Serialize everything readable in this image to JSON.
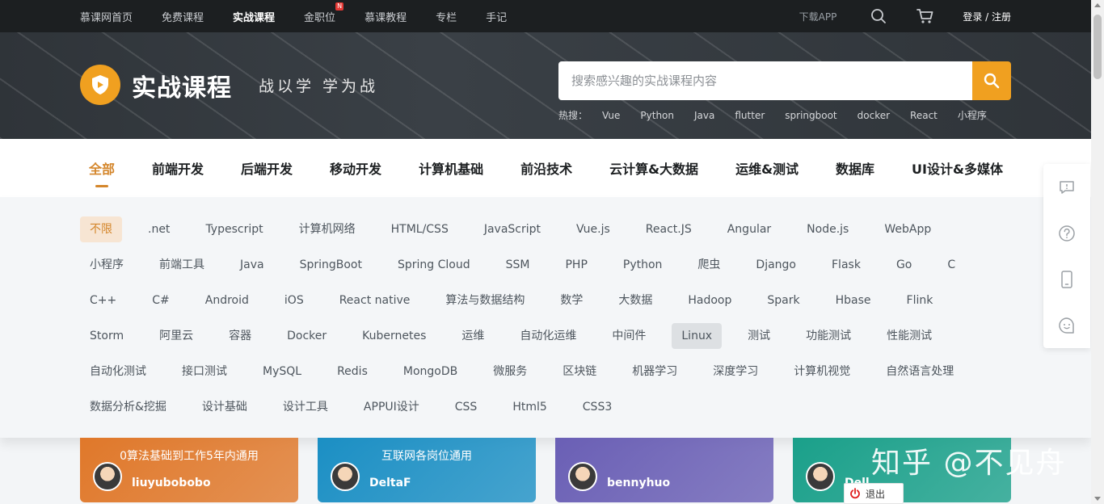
{
  "topnav": {
    "links": [
      {
        "label": "慕课网首页"
      },
      {
        "label": "免费课程"
      },
      {
        "label": "实战课程",
        "active": true
      },
      {
        "label": "金职位",
        "badge": "N"
      },
      {
        "label": "慕课教程"
      },
      {
        "label": "专栏"
      },
      {
        "label": "手记"
      }
    ],
    "download_label": "下载APP",
    "login_label": "登录 / 注册",
    "icons": [
      "search-icon",
      "cart-icon"
    ]
  },
  "hero": {
    "title": "实战课程",
    "slogan": "战以学 学为战",
    "search": {
      "placeholder": "搜索感兴趣的实战课程内容",
      "value": ""
    },
    "hot_label": "热搜：",
    "hot_tags": [
      "Vue",
      "Python",
      "Java",
      "flutter",
      "springboot",
      "docker",
      "React",
      "小程序"
    ]
  },
  "categories": [
    {
      "label": "全部",
      "active": true
    },
    {
      "label": "前端开发"
    },
    {
      "label": "后端开发"
    },
    {
      "label": "移动开发"
    },
    {
      "label": "计算机基础"
    },
    {
      "label": "前沿技术"
    },
    {
      "label": "云计算&大数据"
    },
    {
      "label": "运维&测试"
    },
    {
      "label": "数据库"
    },
    {
      "label": "UI设计&多媒体"
    }
  ],
  "subcategories": [
    "不限",
    ".net",
    "Typescript",
    "计算机网络",
    "HTML/CSS",
    "JavaScript",
    "Vue.js",
    "React.JS",
    "Angular",
    "Node.js",
    "WebApp",
    "小程序",
    "前端工具",
    "Java",
    "SpringBoot",
    "Spring Cloud",
    "SSM",
    "PHP",
    "Python",
    "爬虫",
    "Django",
    "Flask",
    "Go",
    "C",
    "C++",
    "C#",
    "Android",
    "iOS",
    "React native",
    "算法与数据结构",
    "数学",
    "大数据",
    "Hadoop",
    "Spark",
    "Hbase",
    "Flink",
    "Storm",
    "阿里云",
    "容器",
    "Docker",
    "Kubernetes",
    "运维",
    "自动化运维",
    "中间件",
    "Linux",
    "测试",
    "功能测试",
    "性能测试",
    "自动化测试",
    "接口测试",
    "MySQL",
    "Redis",
    "MongoDB",
    "微服务",
    "区块链",
    "机器学习",
    "深度学习",
    "计算机视觉",
    "自然语言处理",
    "数据分析&挖掘",
    "设计基础",
    "设计工具",
    "APPUI设计",
    "CSS",
    "Html5",
    "CSS3"
  ],
  "subcategory_active": "不限",
  "subcategory_hover": "Linux",
  "cards": [
    {
      "subtitle": "0算法基础到工作5年内通用",
      "author": "liuyubobobo",
      "color": "#e0782a"
    },
    {
      "subtitle": "互联网各岗位通用",
      "author": "DeltaF",
      "color": "#1b8fc4"
    },
    {
      "subtitle": "",
      "author": "bennyhuo",
      "color": "#6a5fb5"
    },
    {
      "subtitle": "",
      "author": "Dell",
      "color": "#1aa08a"
    }
  ],
  "float_icons": [
    "feedback-icon",
    "help-icon",
    "mobile-icon",
    "chat-icon"
  ],
  "watermark": "知乎 @不见舟",
  "logout_label": "退出"
}
